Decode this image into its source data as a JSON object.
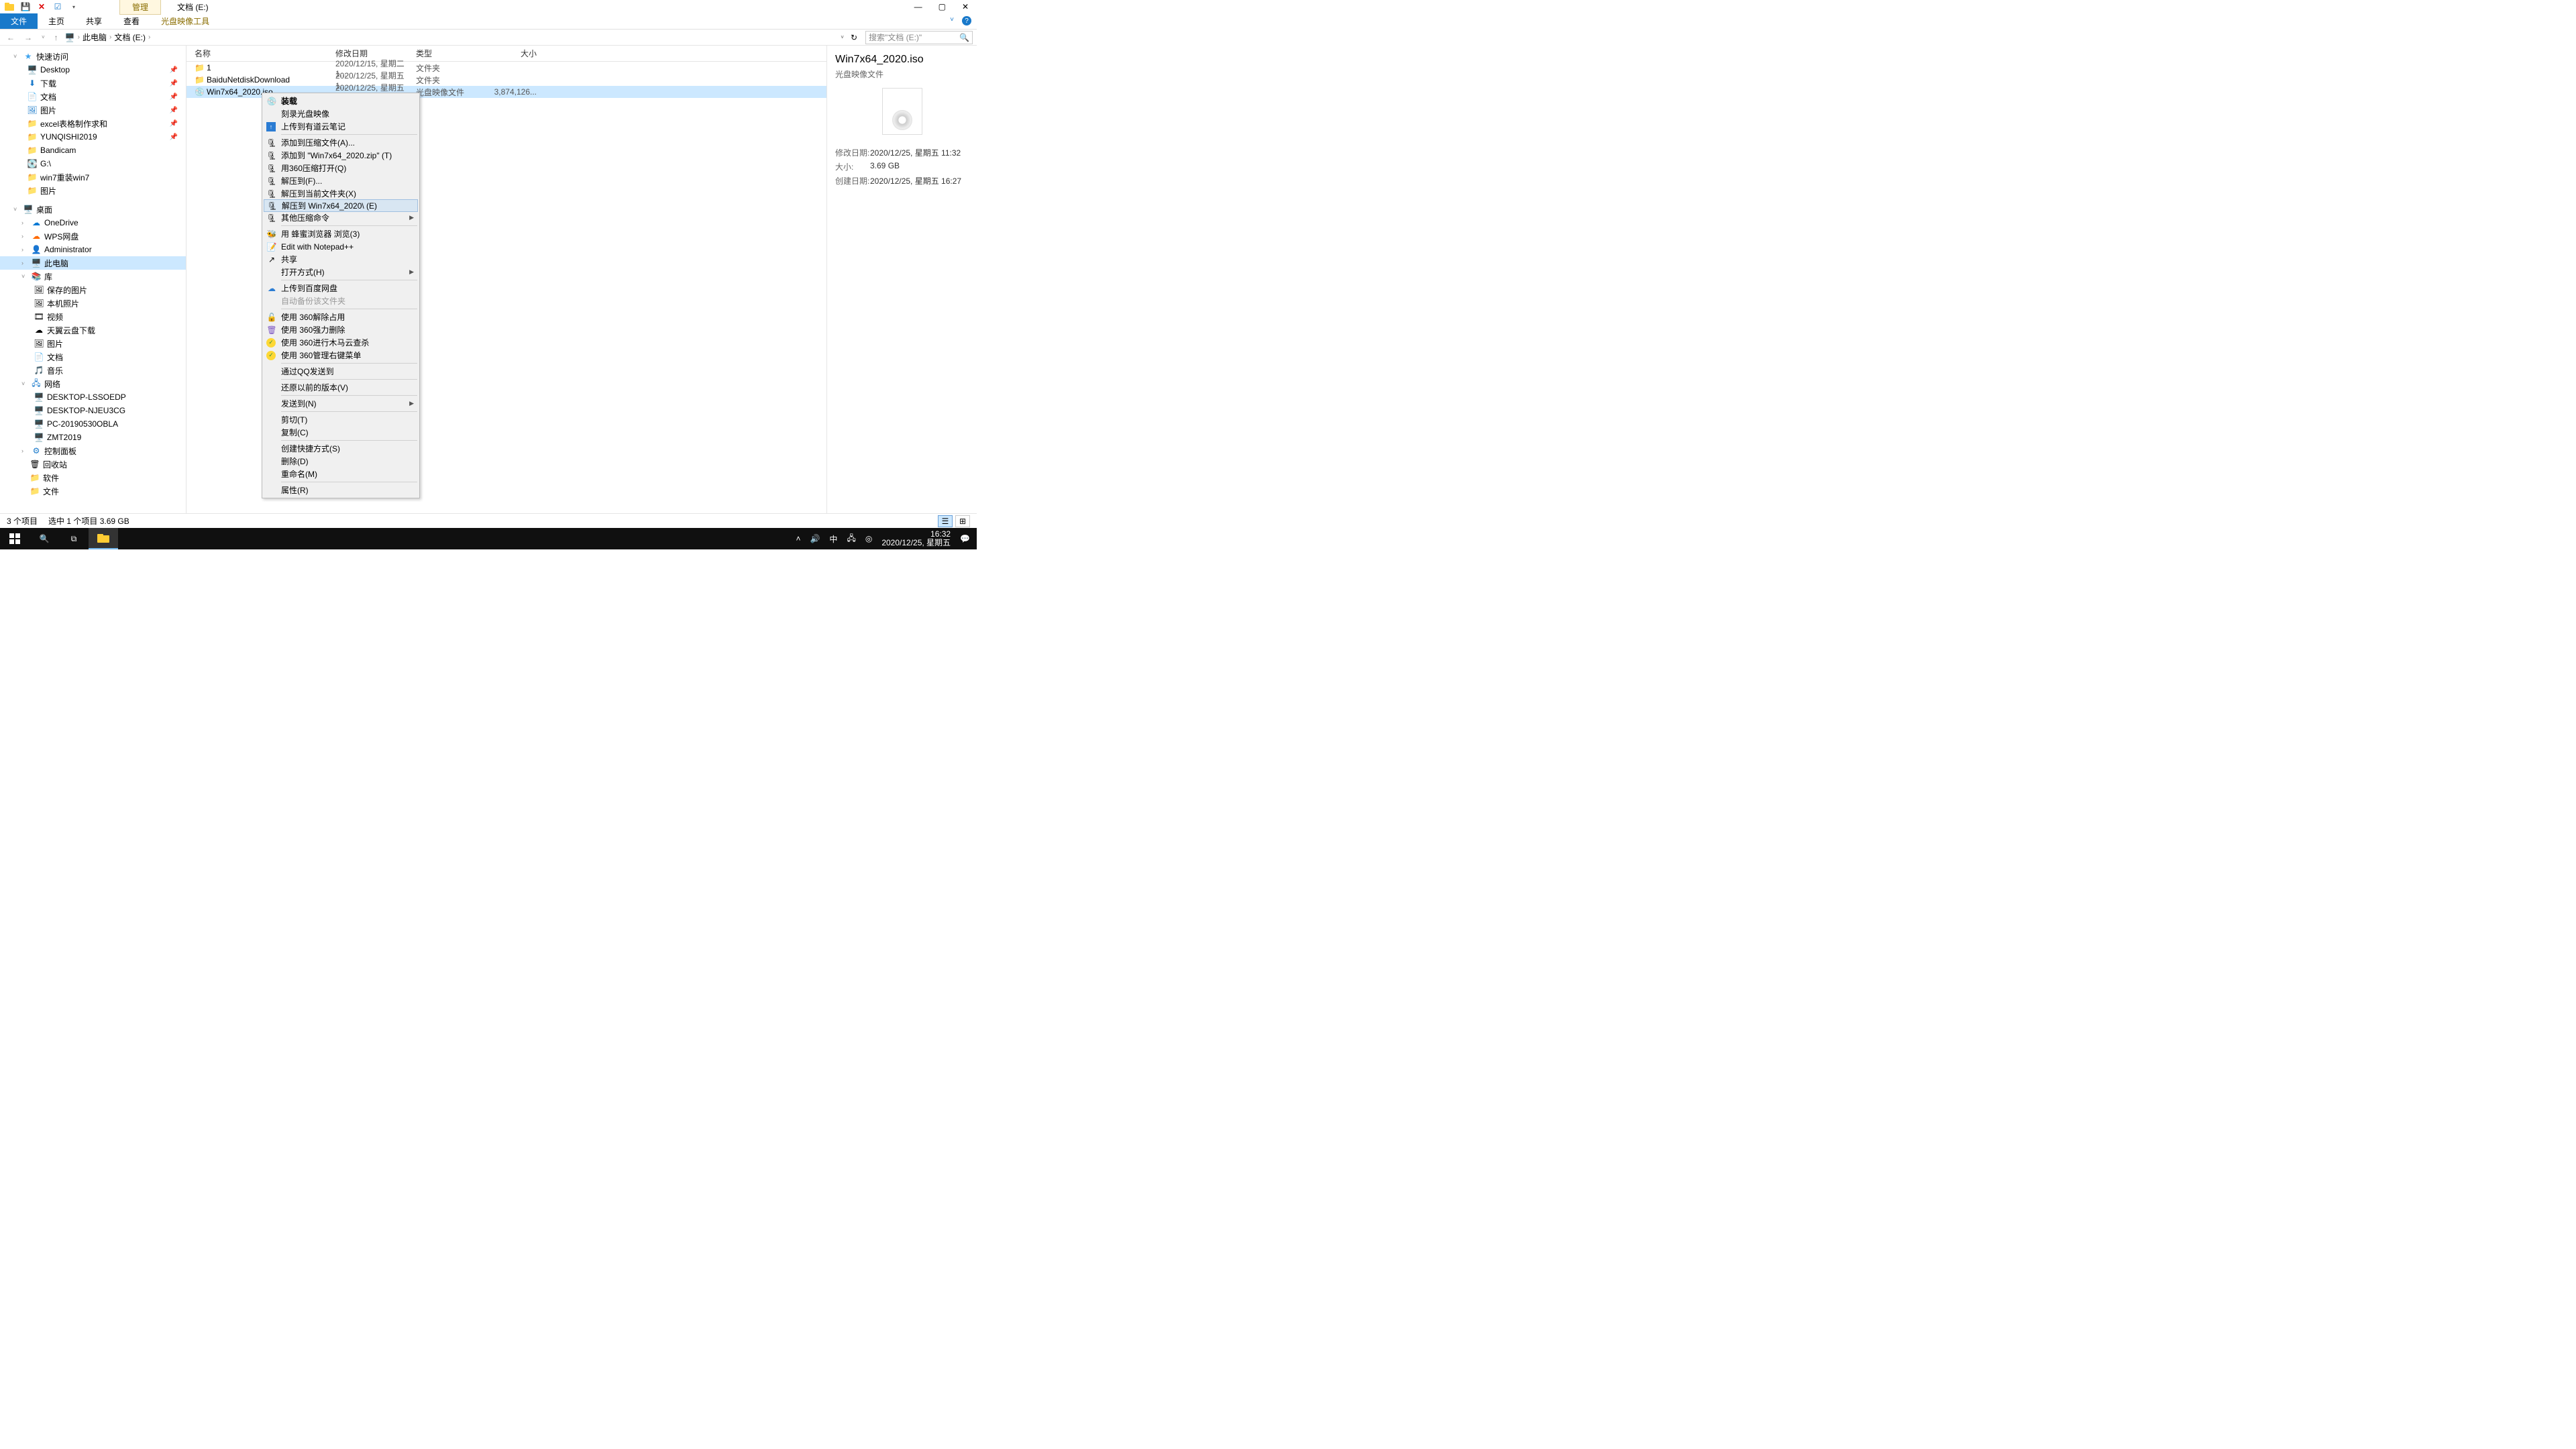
{
  "titlebar": {
    "ribbon_context_tab": "管理",
    "title": "文档 (E:)"
  },
  "ribbon": {
    "file": "文件",
    "home": "主页",
    "share": "共享",
    "view": "查看",
    "disc_tools": "光盘映像工具"
  },
  "address": {
    "root": "此电脑",
    "loc": "文档 (E:)",
    "search_placeholder": "搜索\"文档 (E:)\""
  },
  "nav": {
    "quick": "快速访问",
    "desktop_q": "Desktop",
    "down_q": "下载",
    "docs_q": "文档",
    "pics_q": "图片",
    "excel": "excel表格制作求和",
    "yunqishi": "YUNQISHI2019",
    "bandicam": "Bandicam",
    "g_drive": "G:\\",
    "win7re": "win7重装win7",
    "pics2": "图片",
    "desktop_root": "桌面",
    "onedrive": "OneDrive",
    "wps": "WPS网盘",
    "admin": "Administrator",
    "thispc": "此电脑",
    "libs": "库",
    "saved_pics": "保存的图片",
    "local_pics": "本机照片",
    "video": "视频",
    "tianyi": "天翼云盘下载",
    "pics3": "图片",
    "docs3": "文档",
    "music": "音乐",
    "network": "网络",
    "pc1": "DESKTOP-LSSOEDP",
    "pc2": "DESKTOP-NJEU3CG",
    "pc3": "PC-20190530OBLA",
    "pc4": "ZMT2019",
    "ctrl": "控制面板",
    "recycle": "回收站",
    "soft": "软件",
    "files": "文件"
  },
  "columns": {
    "name": "名称",
    "date": "修改日期",
    "type": "类型",
    "size": "大小"
  },
  "files": [
    {
      "name": "1",
      "date": "2020/12/15, 星期二 1...",
      "type": "文件夹",
      "size": ""
    },
    {
      "name": "BaiduNetdiskDownload",
      "date": "2020/12/25, 星期五 1...",
      "type": "文件夹",
      "size": ""
    },
    {
      "name": "Win7x64_2020.iso",
      "date": "2020/12/25, 星期五 1...",
      "type": "光盘映像文件",
      "size": "3,874,126..."
    }
  ],
  "ctx": {
    "mount": "装载",
    "burn": "刻录光盘映像",
    "youdao": "上传到有道云笔记",
    "add_archive": "添加到压缩文件(A)...",
    "add_zip": "添加到 \"Win7x64_2020.zip\" (T)",
    "open_360": "用360压缩打开(Q)",
    "extract_to": "解压到(F)...",
    "extract_here": "解压到当前文件夹(X)",
    "extract_named": "解压到 Win7x64_2020\\ (E)",
    "other_zip": "其他压缩命令",
    "bee": "用 蜂蜜浏览器 浏览(3)",
    "npp": "Edit with Notepad++",
    "share": "共享",
    "open_with": "打开方式(H)",
    "baidu_up": "上传到百度网盘",
    "auto_backup": "自动备份该文件夹",
    "unlock360": "使用 360解除占用",
    "force_del": "使用 360强力删除",
    "trojan": "使用 360进行木马云查杀",
    "manage_menu": "使用 360管理右键菜单",
    "qq_send": "通过QQ发送到",
    "restore_prev": "还原以前的版本(V)",
    "send_to": "发送到(N)",
    "cut": "剪切(T)",
    "copy": "复制(C)",
    "shortcut": "创建快捷方式(S)",
    "delete": "删除(D)",
    "rename": "重命名(M)",
    "props": "属性(R)"
  },
  "preview": {
    "name": "Win7x64_2020.iso",
    "type": "光盘映像文件",
    "mdate_k": "修改日期:",
    "mdate_v": "2020/12/25, 星期五 11:32",
    "size_k": "大小:",
    "size_v": "3.69 GB",
    "cdate_k": "创建日期:",
    "cdate_v": "2020/12/25, 星期五 16:27"
  },
  "status": {
    "count": "3 个项目",
    "sel": "选中 1 个项目  3.69 GB"
  },
  "taskbar": {
    "ime": "中",
    "time": "16:32",
    "date": "2020/12/25, 星期五"
  }
}
